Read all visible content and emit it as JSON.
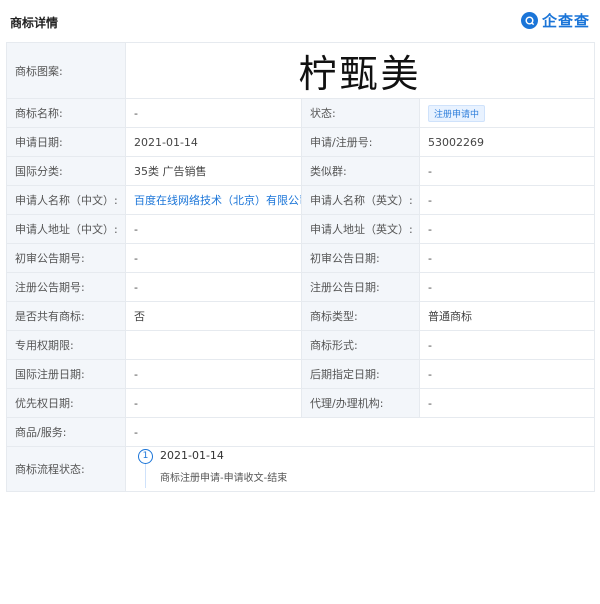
{
  "header": {
    "title": "商标详情",
    "brand": "企查查",
    "brand_color": "#1b75d8"
  },
  "trademark_image": {
    "label": "商标图案:",
    "text": "柠甄美"
  },
  "rows": {
    "name": {
      "label": "商标名称:",
      "value": "-"
    },
    "status": {
      "label": "状态:",
      "value": "注册申请中"
    },
    "apply_date": {
      "label": "申请日期:",
      "value": "2021-01-14"
    },
    "reg_no": {
      "label": "申请/注册号:",
      "value": "53002269"
    },
    "intl_class": {
      "label": "国际分类:",
      "value": "35类 广告销售"
    },
    "similar_group": {
      "label": "类似群:",
      "value": "-"
    },
    "applicant_cn": {
      "label": "申请人名称（中文）:",
      "value": "百度在线网络技术（北京）有限公司"
    },
    "applicant_en": {
      "label": "申请人名称（英文）:",
      "value": "-"
    },
    "address_cn": {
      "label": "申请人地址（中文）:",
      "value": "-"
    },
    "address_en": {
      "label": "申请人地址（英文）:",
      "value": "-"
    },
    "prelim_no": {
      "label": "初审公告期号:",
      "value": "-"
    },
    "prelim_date": {
      "label": "初审公告日期:",
      "value": "-"
    },
    "reg_pub_no": {
      "label": "注册公告期号:",
      "value": "-"
    },
    "reg_pub_date": {
      "label": "注册公告日期:",
      "value": "-"
    },
    "shared": {
      "label": "是否共有商标:",
      "value": "否"
    },
    "mark_type": {
      "label": "商标类型:",
      "value": "普通商标"
    },
    "exclusive_period": {
      "label": "专用权期限:",
      "value": ""
    },
    "mark_form": {
      "label": "商标形式:",
      "value": "-"
    },
    "intl_reg_date": {
      "label": "国际注册日期:",
      "value": "-"
    },
    "later_date": {
      "label": "后期指定日期:",
      "value": "-"
    },
    "priority_date": {
      "label": "优先权日期:",
      "value": "-"
    },
    "agency": {
      "label": "代理/办理机构:",
      "value": "-"
    },
    "goods": {
      "label": "商品/服务:",
      "value": "-"
    }
  },
  "flow": {
    "label": "商标流程状态:",
    "steps": [
      {
        "index": "1",
        "date": "2021-01-14",
        "desc": "商标注册申请-申请收文-结束"
      }
    ]
  }
}
